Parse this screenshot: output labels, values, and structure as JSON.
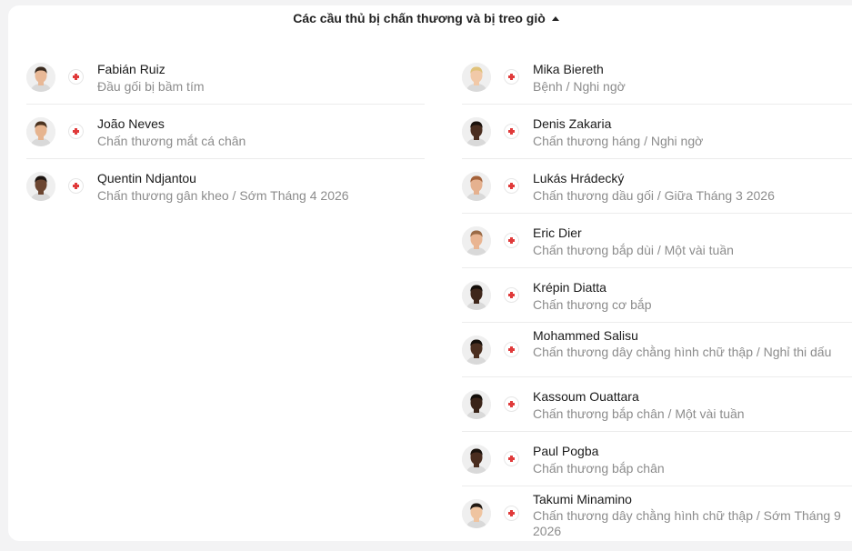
{
  "section": {
    "title": "Các cầu thủ bị chấn thương và bị treo giò"
  },
  "left_players": [
    {
      "name": "Fabián Ruiz",
      "status": "Đầu gối bị bầm tím",
      "skin": "#e8b896",
      "hair": "#3a2a1e"
    },
    {
      "name": "João Neves",
      "status": "Chấn thương mắt cá chân",
      "skin": "#e6b48f",
      "hair": "#4a321f"
    },
    {
      "name": "Quentin Ndjantou",
      "status": "Chấn thương gân kheo / Sớm Tháng 4 2026",
      "skin": "#6b4530",
      "hair": "#1c1410"
    }
  ],
  "right_players": [
    {
      "name": "Mika Biereth",
      "status": "Bệnh / Nghi ngờ",
      "skin": "#f1c9a8",
      "hair": "#e0c27a"
    },
    {
      "name": "Denis Zakaria",
      "status": "Chấn thương háng / Nghi ngờ",
      "skin": "#4a2e20",
      "hair": "#1a120d"
    },
    {
      "name": "Lukás Hrádecký",
      "status": "Chấn thương dầu gối / Giữa Tháng 3 2026",
      "skin": "#e5b18f",
      "hair": "#a4623a"
    },
    {
      "name": "Eric Dier",
      "status": "Chấn thương bắp dùi / Một vài tuần",
      "skin": "#e9b592",
      "hair": "#9a6a45"
    },
    {
      "name": "Krépin Diatta",
      "status": "Chấn thương cơ bắp",
      "skin": "#3f271b",
      "hair": "#140e0a"
    },
    {
      "name": "Mohammed Salisu",
      "status": "Chấn thương dây chằng hình chữ thập / Nghỉ thi dấu",
      "skin": "#4b2f20",
      "hair": "#15100b"
    },
    {
      "name": "Kassoum Ouattara",
      "status": "Chấn thương bắp chân / Một vài tuần",
      "skin": "#3a2418",
      "hair": "#120d09"
    },
    {
      "name": "Paul Pogba",
      "status": "Chấn thương bắp chân",
      "skin": "#4a2d1f",
      "hair": "#1a120c"
    },
    {
      "name": "Takumi Minamino",
      "status": "Chấn thương dây chằng hình chữ thập / Sớm Tháng 9 2026",
      "skin": "#efc4a0",
      "hair": "#201812"
    }
  ],
  "icons": {
    "injury_badge": "red-cross-icon",
    "toggle": "caret-up-icon"
  },
  "colors": {
    "injury": "#e03a3a",
    "secondary_text": "#8c8c8c"
  }
}
